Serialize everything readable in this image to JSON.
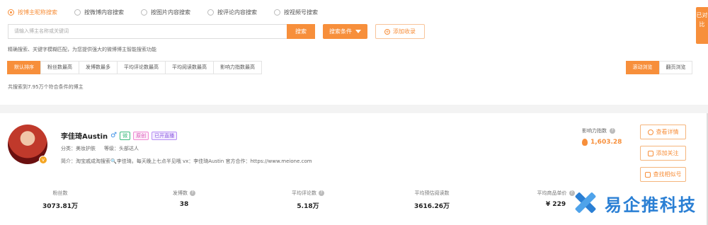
{
  "search_modes": [
    {
      "label": "按博主昵称搜索",
      "selected": true
    },
    {
      "label": "按微博内容搜索",
      "selected": false
    },
    {
      "label": "按图片内容搜索",
      "selected": false
    },
    {
      "label": "按评论内容搜索",
      "selected": false
    },
    {
      "label": "按视频号搜索",
      "selected": false
    }
  ],
  "search": {
    "placeholder": "请输入博主名称或关键词",
    "button": "搜索",
    "conditions_button": "搜索条件",
    "add_button": "添加收录"
  },
  "hint": "精确搜索、关键字模糊匹配，为您提供强大的微博博主智能搜索功能",
  "sort_options": [
    {
      "label": "默认排序",
      "active": true
    },
    {
      "label": "粉丝数最高",
      "active": false
    },
    {
      "label": "发博数最多",
      "active": false
    },
    {
      "label": "平均评论数最高",
      "active": false
    },
    {
      "label": "平均阅读数最高",
      "active": false
    },
    {
      "label": "影响力指数最高",
      "active": false
    }
  ],
  "view_options": [
    {
      "label": "滚动浏览",
      "active": true
    },
    {
      "label": "翻页浏览",
      "active": false
    }
  ],
  "result_count": "共搜索到7.95万个符合条件的博主",
  "compare_tab": "已对比",
  "blogger": {
    "name": "李佳琦Austin",
    "gender_icon": "♂",
    "tags": [
      "微",
      "原创",
      "已开直播"
    ],
    "category": "分类：美妆护肤",
    "level": "等级：头部达人",
    "intro": "简介：淘宝戚成淘搜索🔍李佳琦。每天晚上七点半见哦 vx：李佳琦Austin 官方合作：https://www.meione.com",
    "influence_label": "影响力指数",
    "influence_value": "1,603.28",
    "actions": [
      "查看详情",
      "添加关注",
      "查找相似号"
    ],
    "stats": [
      {
        "label": "粉丝数",
        "value": "3073.81万",
        "help": false
      },
      {
        "label": "发博数",
        "value": "38",
        "help": true
      },
      {
        "label": "平均评论数",
        "value": "5.18万",
        "help": true
      },
      {
        "label": "平均预估阅读数",
        "value": "3616.26万",
        "help": false
      },
      {
        "label": "平均商品单价",
        "value": "¥ 229",
        "help": true
      }
    ]
  },
  "watermark": "易企推科技",
  "colors": {
    "accent": "#f78f3b",
    "watermark": "#2a7fd4"
  }
}
